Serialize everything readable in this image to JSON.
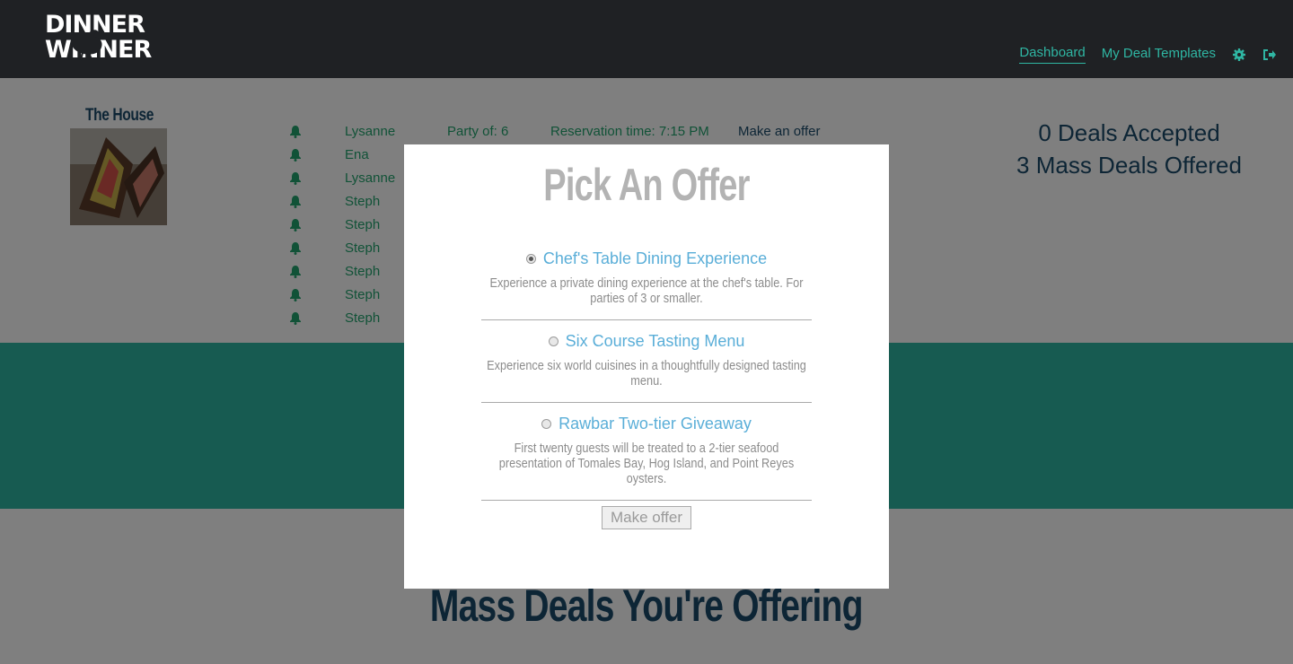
{
  "header": {
    "logo_line1": "DINNER",
    "logo_line2": "WINNER",
    "nav": [
      {
        "label": "Dashboard",
        "active": true
      },
      {
        "label": "My Deal Templates",
        "active": false
      }
    ],
    "icons": [
      "gear-icon",
      "sign-out-icon"
    ]
  },
  "restaurant": {
    "name": "The House"
  },
  "reservations": [
    {
      "guest": "Lysanne",
      "party": "Party of: 6",
      "time": "Reservation time: 7:15 PM",
      "action": "Make an offer"
    },
    {
      "guest": "Ena"
    },
    {
      "guest": "Lysanne"
    },
    {
      "guest": "Steph"
    },
    {
      "guest": "Steph"
    },
    {
      "guest": "Steph"
    },
    {
      "guest": "Steph"
    },
    {
      "guest": "Steph"
    },
    {
      "guest": "Steph"
    }
  ],
  "stats": {
    "accepted": "0 Deals Accepted",
    "mass_offered": "3 Mass Deals Offered"
  },
  "mass_deals": {
    "title": "Mass Deals You're Offering"
  },
  "modal": {
    "title": "Pick An Offer",
    "options": [
      {
        "title": "Chef's Table Dining Experience",
        "description": "Experience a private dining experience at the chef's table. For parties of 3 or smaller.",
        "selected": true
      },
      {
        "title": "Six Course Tasting Menu",
        "description": "Experience six world cuisines in a thoughtfully designed tasting menu.",
        "selected": false
      },
      {
        "title": "Rawbar Two-tier Giveaway",
        "description": "First twenty guests will be treated to a 2-tier seafood presentation of Tomales Bay, Hog Island, and Point Reyes oysters.",
        "selected": false
      }
    ],
    "button_label": "Make offer"
  },
  "colors": {
    "topbar": "#1f2124",
    "accent_teal": "#2fb6a3",
    "green_text": "#23a56f",
    "navy": "#1b4b6b",
    "option_blue": "#5aaed8"
  }
}
